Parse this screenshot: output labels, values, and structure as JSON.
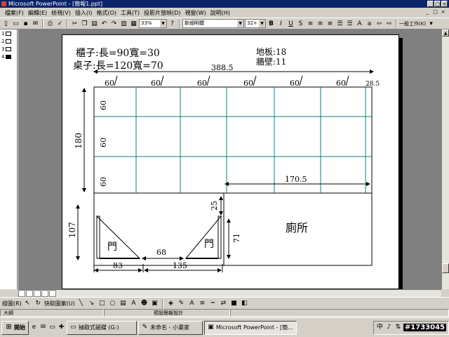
{
  "window": {
    "title": "Microsoft PowerPoint - [簡報1.ppt]",
    "min_label": "_",
    "max_label": "□",
    "close_label": "×"
  },
  "menu": {
    "items": [
      "檔案(F)",
      "編輯(E)",
      "檢視(V)",
      "插入(I)",
      "格式(O)",
      "工具(T)",
      "投影片放映(D)",
      "視窗(W)",
      "說明(H)"
    ],
    "doc_btns": [
      "_",
      "□",
      "×"
    ]
  },
  "toolbar": {
    "zoom": "33%",
    "font_name": "新細明體",
    "font_size": "32+",
    "bold": "B",
    "italic": "I",
    "underline": "U",
    "shadow": "S",
    "common_tasks": "一般工作(K)"
  },
  "outline": {
    "slides": [
      "1",
      "2",
      "3",
      "4"
    ],
    "active_index": 3
  },
  "slide": {
    "header_left": [
      "櫃子:長=90寬=30",
      "桌子:長=120寬=70"
    ],
    "header_right": [
      "地板:18",
      "牆壁:11"
    ],
    "dim_total_width": "388.5",
    "dim_cols": [
      "60",
      "60",
      "60",
      "60",
      "60",
      "60",
      "28.5"
    ],
    "dim_rows": [
      "60",
      "60",
      "60"
    ],
    "dim_height_upper": "180",
    "dim_height_lower": "107",
    "dim_inner_width": "170.5",
    "dim_door_gap_top": "25",
    "dim_door_height": "71",
    "dim_between_doors": "68",
    "dim_bottom_left": "83",
    "dim_bottom_right": "135",
    "door_label_1": "門",
    "door_label_2": "門",
    "bathroom_label": "廁所"
  },
  "drawing_toolbar": {
    "draw_label": "繪圖(R)",
    "autoshapes_label": "快取圖案(U)"
  },
  "status": {
    "outline_label": "大綱",
    "design_label": "預設簡報設計"
  },
  "taskbar": {
    "start_label": "開始",
    "tasks": [
      "抽取式磁碟 (G:)",
      "未命名 - 小畫家",
      "Microsoft PowerPoint - [簡..."
    ],
    "watermark": "#1733045"
  },
  "colors": {
    "grid_line": "#008080",
    "titlebar": "#0a246a"
  }
}
